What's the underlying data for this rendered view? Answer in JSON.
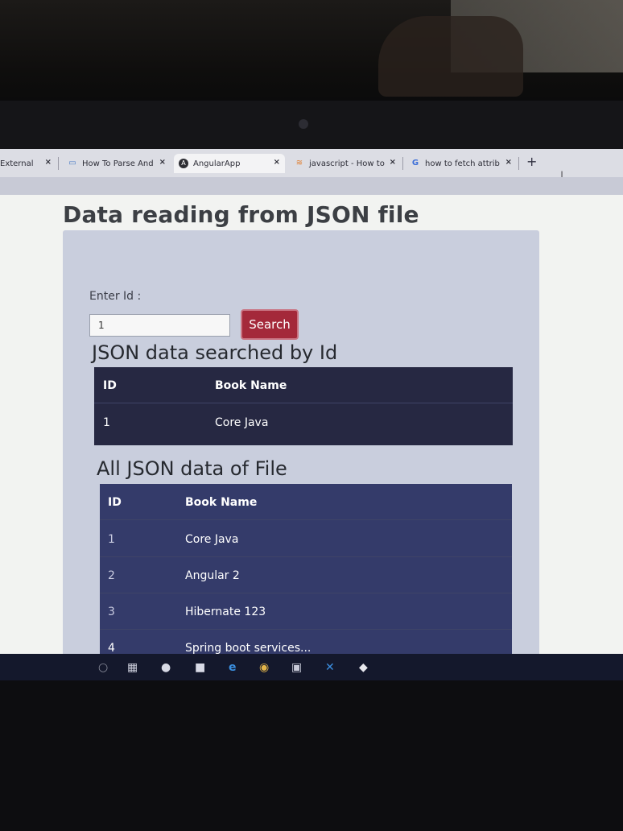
{
  "browser": {
    "tabs": [
      {
        "label": "External",
        "icon": "document-icon"
      },
      {
        "label": "How To Parse And",
        "icon": "document-icon"
      },
      {
        "label": "AngularApp",
        "icon": "angular-icon"
      },
      {
        "label": "javascript - How to",
        "icon": "stackoverflow-icon"
      },
      {
        "label": "how to fetch attrib",
        "icon": "google-icon"
      }
    ],
    "close_glyph": "×",
    "new_tab_glyph": "+"
  },
  "page": {
    "title": "Data reading from JSON file",
    "enter_id_label": "Enter Id :",
    "id_input_value": "1",
    "search_button": "Search",
    "searched_heading": "JSON data searched by Id",
    "all_heading": "All JSON data of File",
    "searched_table": {
      "headers": [
        "ID",
        "Book Name"
      ],
      "rows": [
        [
          "1",
          "Core Java"
        ]
      ]
    },
    "all_table": {
      "headers": [
        "ID",
        "Book Name"
      ],
      "rows": [
        [
          "1",
          "Core Java"
        ],
        [
          "2",
          "Angular 2"
        ],
        [
          "3",
          "Hibernate 123"
        ],
        [
          "4",
          "Spring boot services..."
        ]
      ]
    }
  },
  "taskbar": {
    "icons": [
      "search-icon",
      "task-view-icon",
      "cortana-icon",
      "file-explorer-icon",
      "edge-icon",
      "chrome-icon",
      "terminal-icon",
      "vscode-icon",
      "app-icon"
    ]
  },
  "colors": {
    "button": "#a4293a",
    "table_dark": "#262842",
    "table_blue": "#343b6a",
    "panel": "#c9cedd"
  }
}
